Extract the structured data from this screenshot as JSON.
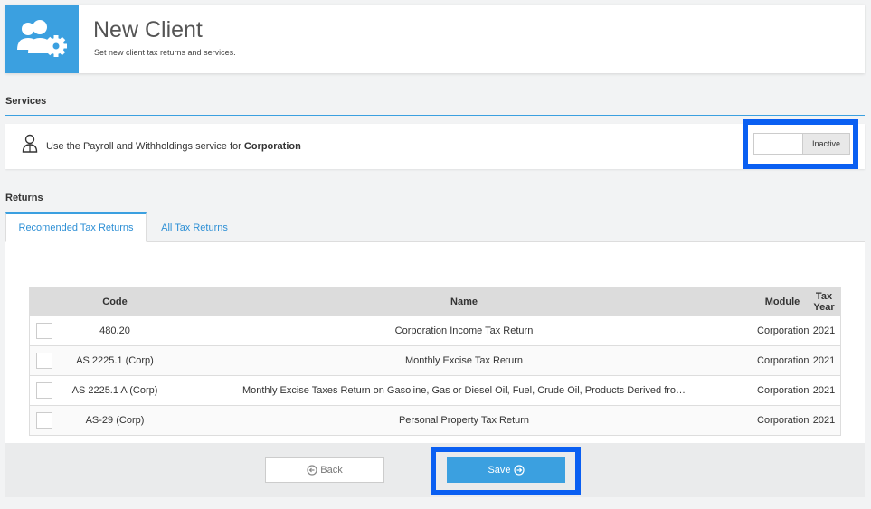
{
  "header": {
    "title": "New Client",
    "subtitle": "Set new client tax returns and services.",
    "icon": "users-gear-icon",
    "accent_color": "#3ba0e0"
  },
  "services": {
    "section_label": "Services",
    "text_prefix": "Use the Payroll and Withholdings service for ",
    "text_entity": "Corporation",
    "toggle_state_label": "Inactive"
  },
  "returns": {
    "section_label": "Returns",
    "tabs": [
      {
        "label": "Recomended Tax Returns",
        "active": true
      },
      {
        "label": "All Tax Returns",
        "active": false
      }
    ],
    "columns": {
      "code": "Code",
      "name": "Name",
      "module": "Module",
      "tax_year": "Tax Year"
    },
    "rows": [
      {
        "code": "480.20",
        "name": "Corporation Income Tax Return",
        "module": "Corporation",
        "tax_year": "2021",
        "checked": false
      },
      {
        "code": "AS 2225.1 (Corp)",
        "name": "Monthly Excise Tax Return",
        "module": "Corporation",
        "tax_year": "2021",
        "checked": false
      },
      {
        "code": "AS 2225.1 A (Corp)",
        "name": "Monthly Excise Taxes Return on Gasoline, Gas or Diesel Oil, Fuel, Crude Oil, Products Derived fro…",
        "module": "Corporation",
        "tax_year": "2021",
        "checked": false
      },
      {
        "code": "AS-29 (Corp)",
        "name": "Personal Property Tax Return",
        "module": "Corporation",
        "tax_year": "2021",
        "checked": false
      }
    ]
  },
  "footer": {
    "back_label": "Back",
    "save_label": "Save",
    "back_icon": "circle-arrow-left-icon",
    "save_icon": "circle-arrow-right-icon"
  },
  "highlight_color": "#0a5ff2"
}
